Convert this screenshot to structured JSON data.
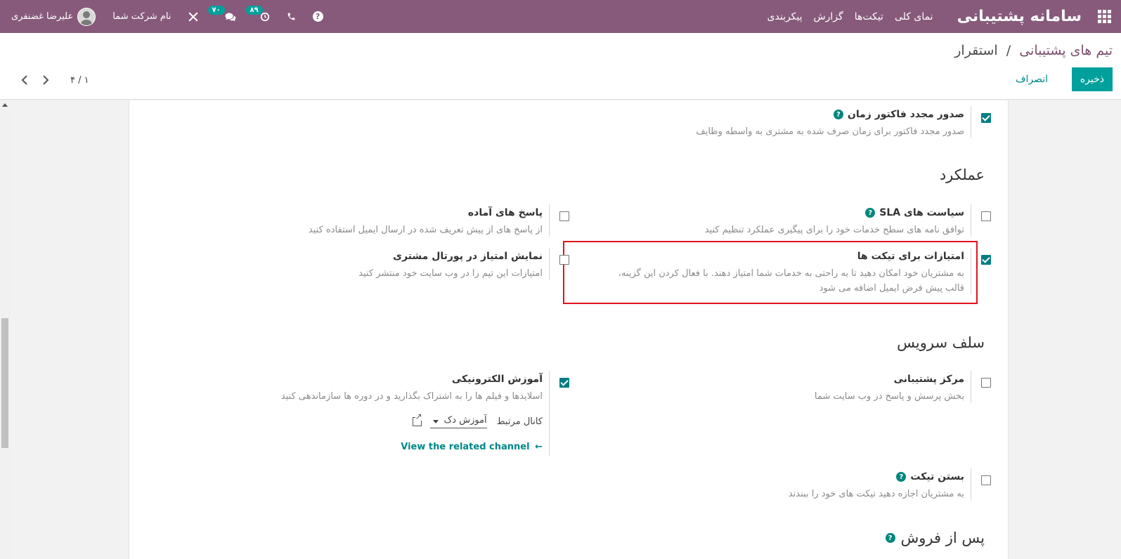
{
  "navbar": {
    "brand": "سامانه پشتیبانی",
    "menu": [
      {
        "label": "نمای کلی"
      },
      {
        "label": "تیکت‌ها"
      },
      {
        "label": "گزارش"
      },
      {
        "label": "پیکربندی"
      }
    ],
    "activity_count": "۸۹",
    "messages_count": "۷۰",
    "company": "نام شرکت شما",
    "user": "علیرضا غضنفری",
    "colors": {
      "bar": "#875a7b",
      "badge": "#00a09d"
    }
  },
  "control": {
    "breadcrumb_parent": "تیم های پشتیبانی",
    "breadcrumb_sep": "/",
    "breadcrumb_current": "استقرار",
    "save_label": "ذخیره",
    "discard_label": "انصراف",
    "pager": "۴ / ۱"
  },
  "sections": {
    "performance": "عملکرد",
    "self_service": "سلف سرویس",
    "after_sales": "پس از فروش"
  },
  "settings": {
    "reinvoice": {
      "title": "صدور مجدد فاکتور زمان",
      "desc": "صدور مجدد فاکتور برای زمان صرف شده به مشتری به واسطه وظایف",
      "checked": true
    },
    "sla": {
      "title": "سیاست های SLA",
      "desc": "توافق نامه های سطح خدمات خود را برای پیگیری عملکرد تنظیم کنید",
      "checked": false
    },
    "canned": {
      "title": "پاسخ های آماده",
      "desc": "از پاسخ های از پیش تعریف شده در ارسال ایمیل استفاده کنید",
      "checked": false
    },
    "ratings": {
      "title": "امتیازات برای تیکت ها",
      "desc": "به مشتریان خود امکان دهید تا به راحتی به خدمات شما امتیاز دهند. با فعال کردن این گزینه، قالب پیش فرض ایمیل اضافه می شود",
      "checked": true
    },
    "portal_rating": {
      "title": "نمایش امتیاز در پورتال مشتری",
      "desc": "امتیازات این تیم را در وب سایت خود منتشر کنید",
      "checked": false
    },
    "help_center": {
      "title": "مرکز پشتیبانی",
      "desc": "بخش پرسش و پاسخ در وب سایت شما",
      "checked": false
    },
    "elearning": {
      "title": "آموزش الکترونیکی",
      "desc": "اسلایدها و فیلم ها را به اشتراک بگذارید و در دوره ها سازماندهی کنید",
      "checked": true,
      "channel_label": "کانال مرتبط",
      "channel_value": "آموزش دک",
      "related_link": "View the related channel"
    },
    "closing": {
      "title": "بستن تیکت",
      "desc": "به مشتریان اجازه دهید تیکت های خود را ببندند",
      "checked": false
    }
  }
}
